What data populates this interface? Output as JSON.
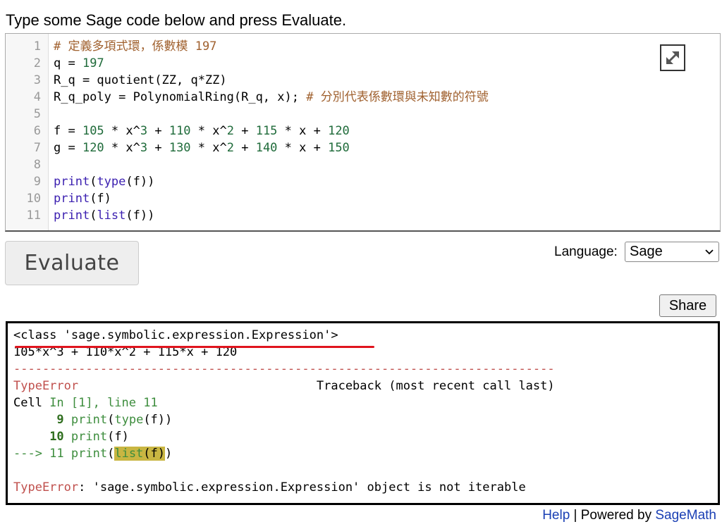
{
  "instructions": "Type some Sage code below and press Evaluate.",
  "editor": {
    "lines": [
      {
        "n": "1",
        "parts": [
          {
            "t": "# 定義多項式環，係數模 197",
            "c": "comment"
          }
        ]
      },
      {
        "n": "2",
        "parts": [
          {
            "t": "q = "
          },
          {
            "t": "197",
            "c": "num"
          }
        ]
      },
      {
        "n": "3",
        "parts": [
          {
            "t": "R_q = quotient(ZZ, q*ZZ)"
          }
        ]
      },
      {
        "n": "4",
        "parts": [
          {
            "t": "R_q_poly = PolynomialRing(R_q, x); "
          },
          {
            "t": "# 分別代表係數環與未知數的符號",
            "c": "comment"
          }
        ]
      },
      {
        "n": "5",
        "parts": []
      },
      {
        "n": "6",
        "parts": [
          {
            "t": "f = "
          },
          {
            "t": "105",
            "c": "num"
          },
          {
            "t": " * x^"
          },
          {
            "t": "3",
            "c": "num"
          },
          {
            "t": " + "
          },
          {
            "t": "110",
            "c": "num"
          },
          {
            "t": " * x^"
          },
          {
            "t": "2",
            "c": "num"
          },
          {
            "t": " + "
          },
          {
            "t": "115",
            "c": "num"
          },
          {
            "t": " * x + "
          },
          {
            "t": "120",
            "c": "num"
          }
        ]
      },
      {
        "n": "7",
        "parts": [
          {
            "t": "g = "
          },
          {
            "t": "120",
            "c": "num"
          },
          {
            "t": " * x^"
          },
          {
            "t": "3",
            "c": "num"
          },
          {
            "t": " + "
          },
          {
            "t": "130",
            "c": "num"
          },
          {
            "t": " * x^"
          },
          {
            "t": "2",
            "c": "num"
          },
          {
            "t": " + "
          },
          {
            "t": "140",
            "c": "num"
          },
          {
            "t": " * x + "
          },
          {
            "t": "150",
            "c": "num"
          }
        ]
      },
      {
        "n": "8",
        "parts": []
      },
      {
        "n": "9",
        "parts": [
          {
            "t": "print",
            "c": "kw"
          },
          {
            "t": "("
          },
          {
            "t": "type",
            "c": "kw"
          },
          {
            "t": "(f))"
          }
        ]
      },
      {
        "n": "10",
        "parts": [
          {
            "t": "print",
            "c": "kw"
          },
          {
            "t": "(f)"
          }
        ]
      },
      {
        "n": "11",
        "parts": [
          {
            "t": "print",
            "c": "kw"
          },
          {
            "t": "("
          },
          {
            "t": "list",
            "c": "kw"
          },
          {
            "t": "(f))"
          }
        ]
      }
    ]
  },
  "toolbar": {
    "evaluate_label": "Evaluate",
    "language_label": "Language:",
    "language_value": "Sage",
    "share_label": "Share"
  },
  "output": {
    "lines": [
      [
        {
          "t": "<class 'sage.symbolic.expression.Expression'>"
        }
      ],
      [
        {
          "t": "105*x^3 + 110*x^2 + 115*x + 120"
        }
      ],
      [
        {
          "t": "---------------------------------------------------------------------------",
          "c": "red"
        }
      ],
      [
        {
          "t": "TypeError",
          "c": "red"
        },
        {
          "t": "                                 Traceback (most recent call last)"
        }
      ],
      [
        {
          "t": "Cell "
        },
        {
          "t": "In [1], line 11",
          "c": "green"
        }
      ],
      [
        {
          "t": "      "
        },
        {
          "t": "9",
          "c": "boldgreen"
        },
        {
          "t": " "
        },
        {
          "t": "print",
          "c": "green"
        },
        {
          "t": "("
        },
        {
          "t": "type",
          "c": "green"
        },
        {
          "t": "(f))"
        }
      ],
      [
        {
          "t": "     "
        },
        {
          "t": "10",
          "c": "boldgreen"
        },
        {
          "t": " "
        },
        {
          "t": "print",
          "c": "green"
        },
        {
          "t": "(f)"
        }
      ],
      [
        {
          "t": "---> 11",
          "c": "green"
        },
        {
          "t": " "
        },
        {
          "t": "print",
          "c": "green"
        },
        {
          "t": "("
        },
        {
          "t": "list",
          "c": "hl"
        },
        {
          "t": "(f)",
          "c": "hlblack"
        },
        {
          "t": ")"
        }
      ],
      [],
      [
        {
          "t": "TypeError",
          "c": "red"
        },
        {
          "t": ": 'sage.symbolic.expression.Expression' object is not iterable"
        }
      ]
    ]
  },
  "footer": {
    "help": "Help",
    "separator": " | Powered by ",
    "sagemath": "SageMath"
  },
  "colors": {
    "comment": "#a0612f",
    "number": "#1f6b3a",
    "keyword": "#3b1fb0",
    "error": "#c0504d",
    "highlight": "#c9b642",
    "annotation_underline": "#e0141e",
    "link": "#1a3fb4"
  }
}
